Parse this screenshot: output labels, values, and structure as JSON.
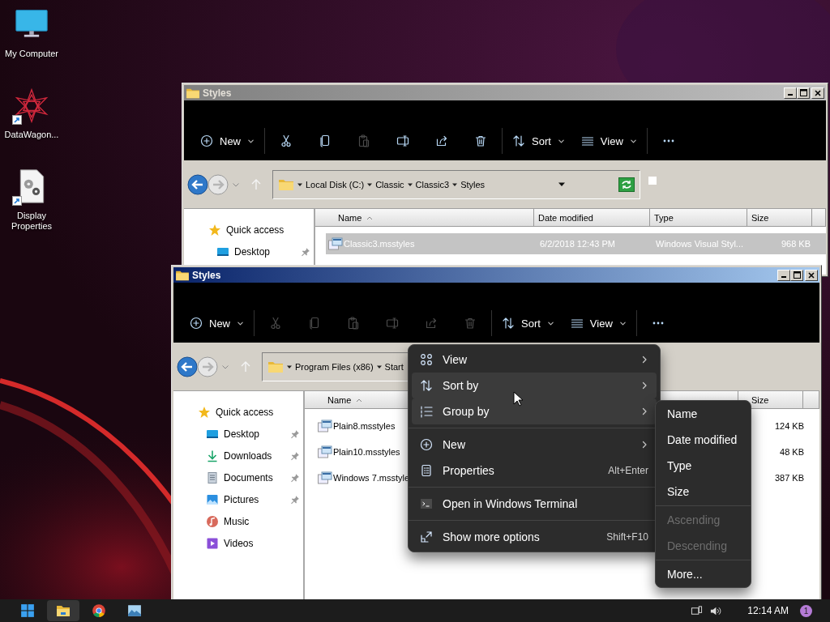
{
  "desktop_icons": [
    {
      "label": "My Computer",
      "kind": "computer",
      "shortcut": false
    },
    {
      "label": "DataWagon...",
      "kind": "wagon",
      "shortcut": true
    },
    {
      "label": "Display Properties",
      "kind": "settings_file",
      "shortcut": true
    }
  ],
  "windows": [
    {
      "title": "Styles",
      "focused": false,
      "toolbar": [
        [
          {
            "kind": "new",
            "label": "New",
            "disabled": false
          }
        ],
        [
          {
            "kind": "cut",
            "disabled": false
          },
          {
            "kind": "copy",
            "disabled": false
          },
          {
            "kind": "paste",
            "disabled": true
          },
          {
            "kind": "rename",
            "disabled": false
          },
          {
            "kind": "share",
            "disabled": false
          },
          {
            "kind": "delete",
            "disabled": false
          }
        ],
        [
          {
            "kind": "sort",
            "label": "Sort",
            "disabled": false
          },
          {
            "kind": "view",
            "label": "View",
            "disabled": false
          }
        ],
        [
          {
            "kind": "more",
            "disabled": false
          }
        ]
      ],
      "address": {
        "crumbs": [
          "Local Disk (C:)",
          "Classic",
          "Classic3",
          "Styles"
        ],
        "dropdown": true,
        "refresh": true,
        "box": true
      },
      "nav": [
        {
          "label": "Quick access",
          "kind": "star",
          "pinned": false,
          "children": [
            {
              "label": "Desktop",
              "kind": "desktop",
              "pinned": true
            }
          ]
        }
      ],
      "columns": [
        {
          "label": "Name",
          "kind": "name",
          "sorted": true
        },
        {
          "label": "Date modified",
          "kind": "date",
          "sorted": false
        },
        {
          "label": "Type",
          "kind": "type",
          "sorted": false
        },
        {
          "label": "Size",
          "kind": "size",
          "sorted": false
        }
      ],
      "files": [
        {
          "name": "Classic3.msstyles",
          "date": "6/2/2018 12:43 PM",
          "type": "Windows Visual Styl...",
          "size": "968 KB",
          "selected": true
        }
      ]
    },
    {
      "title": "Styles",
      "focused": true,
      "toolbar": [
        [
          {
            "kind": "new",
            "label": "New",
            "disabled": false
          }
        ],
        [
          {
            "kind": "cut",
            "disabled": true
          },
          {
            "kind": "copy",
            "disabled": true
          },
          {
            "kind": "paste",
            "disabled": true
          },
          {
            "kind": "rename",
            "disabled": true
          },
          {
            "kind": "share",
            "disabled": true
          },
          {
            "kind": "delete",
            "disabled": true
          }
        ],
        [
          {
            "kind": "sort",
            "label": "Sort",
            "disabled": false
          },
          {
            "kind": "view",
            "label": "View",
            "disabled": false
          }
        ],
        [
          {
            "kind": "more",
            "disabled": false
          }
        ]
      ],
      "address": {
        "crumbs": [
          "Program Files (x86)",
          "Start"
        ]
      },
      "nav": [
        {
          "label": "Quick access",
          "kind": "star",
          "pinned": false,
          "children": [
            {
              "label": "Desktop",
              "kind": "desktop",
              "pinned": true
            },
            {
              "label": "Downloads",
              "kind": "downloads",
              "pinned": true
            },
            {
              "label": "Documents",
              "kind": "documents",
              "pinned": true
            },
            {
              "label": "Pictures",
              "kind": "pictures",
              "pinned": true
            },
            {
              "label": "Music",
              "kind": "music",
              "pinned": false
            },
            {
              "label": "Videos",
              "kind": "videos",
              "pinned": false
            }
          ]
        }
      ],
      "columns": [
        {
          "label": "Name",
          "kind": "name",
          "sorted": true
        },
        {
          "label": "Size",
          "kind": "size",
          "sorted": false
        }
      ],
      "files": [
        {
          "name": "Plain8.msstyles",
          "size": "124 KB",
          "selected": false
        },
        {
          "name": "Plain10.msstyles",
          "size": "48 KB",
          "selected": false
        },
        {
          "name": "Windows 7.msstyle",
          "size": "387 KB",
          "selected": false
        }
      ]
    }
  ],
  "context_menu": {
    "groups": [
      [
        {
          "kind": "view",
          "label": "View",
          "submenu": true,
          "highlighted": false
        },
        {
          "kind": "sort",
          "label": "Sort by",
          "submenu": true,
          "highlighted": true
        },
        {
          "kind": "group",
          "label": "Group by",
          "submenu": true,
          "highlighted": true
        }
      ],
      [
        {
          "kind": "new",
          "label": "New",
          "submenu": true,
          "highlighted": false
        },
        {
          "kind": "properties",
          "label": "Properties",
          "shortcut": "Alt+Enter",
          "submenu": false,
          "highlighted": false
        }
      ],
      [
        {
          "kind": "terminal",
          "label": "Open in Windows Terminal",
          "submenu": false,
          "highlighted": false
        }
      ],
      [
        {
          "kind": "more_options",
          "label": "Show more options",
          "shortcut": "Shift+F10",
          "submenu": false,
          "highlighted": false
        }
      ]
    ]
  },
  "submenu": {
    "groups": [
      [
        {
          "label": "Name",
          "disabled": false
        },
        {
          "label": "Date modified",
          "disabled": false
        },
        {
          "label": "Type",
          "disabled": false
        },
        {
          "label": "Size",
          "disabled": false
        }
      ],
      [
        {
          "label": "Ascending",
          "disabled": true
        },
        {
          "label": "Descending",
          "disabled": true
        }
      ],
      [
        {
          "label": "More...",
          "disabled": false
        }
      ]
    ]
  },
  "taskbar": {
    "apps": [
      {
        "kind": "start",
        "active": false
      },
      {
        "kind": "explorer",
        "active": true
      },
      {
        "kind": "browser",
        "active": false
      },
      {
        "kind": "photos",
        "active": false
      }
    ],
    "clock": "12:14 AM",
    "badge": "1"
  }
}
